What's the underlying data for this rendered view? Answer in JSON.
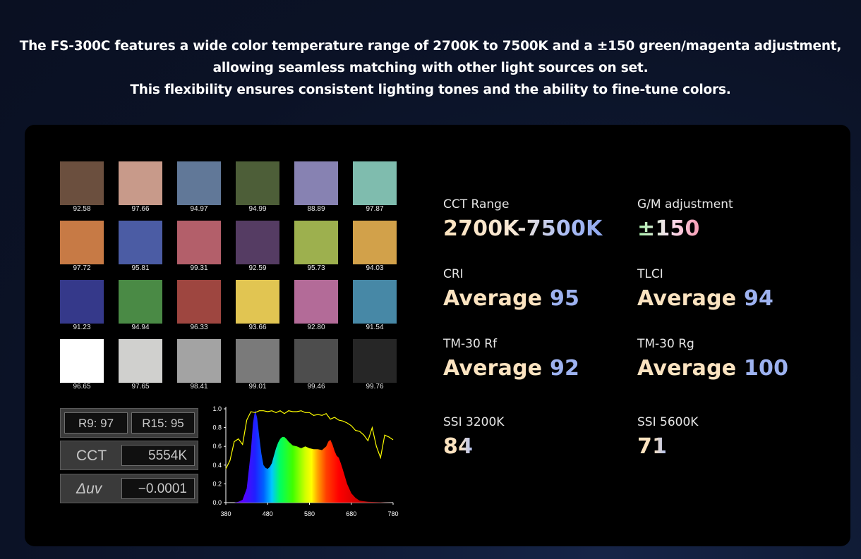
{
  "intro": {
    "line1": "The FS-300C features a wide color temperature range of 2700K to 7500K and a ±150 green/magenta adjustment,",
    "line2": "allowing seamless matching with other light sources on set.",
    "line3": "This flexibility ensures consistent lighting tones and the ability to fine-tune colors."
  },
  "swatches": [
    {
      "value": "92.58",
      "color": "#6b4f3e"
    },
    {
      "value": "97.66",
      "color": "#c89a8a"
    },
    {
      "value": "94.97",
      "color": "#617898"
    },
    {
      "value": "94.99",
      "color": "#4d5e38"
    },
    {
      "value": "88.89",
      "color": "#8782b2"
    },
    {
      "value": "97.87",
      "color": "#7fbcae"
    },
    {
      "value": "97.72",
      "color": "#c77a45"
    },
    {
      "value": "95.81",
      "color": "#4b5ca4"
    },
    {
      "value": "99.31",
      "color": "#b35f6a"
    },
    {
      "value": "92.59",
      "color": "#553c63"
    },
    {
      "value": "95.73",
      "color": "#9db04e"
    },
    {
      "value": "94.03",
      "color": "#d2a14a"
    },
    {
      "value": "91.23",
      "color": "#35398a"
    },
    {
      "value": "94.94",
      "color": "#4a8a45"
    },
    {
      "value": "96.33",
      "color": "#9e4640"
    },
    {
      "value": "93.66",
      "color": "#e1c552"
    },
    {
      "value": "92.80",
      "color": "#b36b98"
    },
    {
      "value": "91.54",
      "color": "#4788a6"
    },
    {
      "value": "96.65",
      "color": "#ffffff"
    },
    {
      "value": "97.65",
      "color": "#d0d0ce"
    },
    {
      "value": "98.41",
      "color": "#a3a3a3"
    },
    {
      "value": "99.01",
      "color": "#7a7a7a"
    },
    {
      "value": "99.46",
      "color": "#4d4d4d"
    },
    {
      "value": "99.76",
      "color": "#262626"
    }
  ],
  "meter": {
    "r9": "R9: 97",
    "r15": "R15: 95",
    "cct_label": "CCT",
    "cct_value": "5554K",
    "duv_label": "Δuv",
    "duv_value": "−0.0001"
  },
  "chart_data": {
    "type": "area",
    "xlim": [
      380,
      780
    ],
    "ylim": [
      0,
      1
    ],
    "x_ticks": [
      "380",
      "480",
      "580",
      "680",
      "780"
    ],
    "y_ticks": [
      "0.0",
      "0.2",
      "0.4",
      "0.6",
      "0.8",
      "1.0"
    ],
    "series": [
      {
        "color": "#ffff00",
        "x": [
          380,
          390,
          400,
          410,
          420,
          430,
          440,
          450,
          460,
          470,
          480,
          490,
          500,
          510,
          520,
          530,
          540,
          550,
          560,
          570,
          580,
          590,
          600,
          610,
          620,
          630,
          640,
          650,
          660,
          670,
          680,
          690,
          700,
          710,
          720,
          730,
          740,
          750,
          760,
          770,
          780
        ],
        "y": [
          0.36,
          0.45,
          0.65,
          0.68,
          0.62,
          0.88,
          0.97,
          0.96,
          0.98,
          0.98,
          0.97,
          0.98,
          0.96,
          0.98,
          0.95,
          0.98,
          0.97,
          0.97,
          0.98,
          0.96,
          0.96,
          0.93,
          0.94,
          0.93,
          0.95,
          0.89,
          0.91,
          0.88,
          0.87,
          0.85,
          0.82,
          0.77,
          0.76,
          0.72,
          0.66,
          0.8,
          0.6,
          0.48,
          0.72,
          0.7,
          0.67
        ]
      },
      {
        "color": "spectral",
        "x": [
          380,
          400,
          410,
          420,
          430,
          440,
          445,
          450,
          455,
          460,
          465,
          470,
          475,
          480,
          485,
          490,
          495,
          500,
          505,
          510,
          515,
          520,
          525,
          530,
          540,
          550,
          560,
          570,
          580,
          590,
          600,
          610,
          620,
          625,
          630,
          635,
          640,
          645,
          650,
          655,
          660,
          670,
          680,
          690,
          700,
          720,
          740,
          760,
          780
        ],
        "y": [
          0.0,
          0.0,
          0.01,
          0.03,
          0.15,
          0.55,
          0.85,
          0.99,
          0.9,
          0.7,
          0.52,
          0.4,
          0.37,
          0.36,
          0.38,
          0.42,
          0.5,
          0.58,
          0.64,
          0.68,
          0.7,
          0.7,
          0.68,
          0.65,
          0.61,
          0.6,
          0.58,
          0.6,
          0.58,
          0.57,
          0.57,
          0.56,
          0.6,
          0.65,
          0.67,
          0.62,
          0.55,
          0.5,
          0.48,
          0.42,
          0.35,
          0.2,
          0.1,
          0.05,
          0.02,
          0.01,
          0.005,
          0.002,
          0.0
        ]
      }
    ]
  },
  "stats": [
    {
      "label": "CCT Range",
      "value": "2700K-7500K"
    },
    {
      "label": "G/M adjustment",
      "value": "±150"
    },
    {
      "label": "CRI",
      "value_prefix": "Average",
      "value_number": "95"
    },
    {
      "label": "TLCI",
      "value_prefix": "Average",
      "value_number": "94"
    },
    {
      "label": "TM-30 Rf",
      "value_prefix": "Average",
      "value_number": "92"
    },
    {
      "label": "TM-30 Rg",
      "value_prefix": "Average",
      "value_number": "100"
    },
    {
      "label": "SSI 3200K",
      "value": "84"
    },
    {
      "label": "SSI 5600K",
      "value": "71"
    }
  ]
}
